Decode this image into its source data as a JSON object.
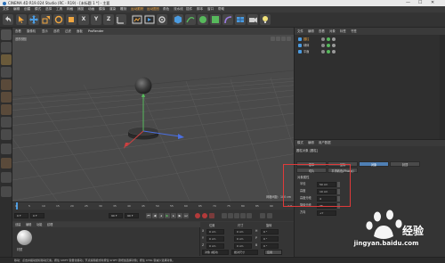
{
  "titlebar": {
    "title": "CINEMA 4D R19.024 Studio (RC - R19) - [未标题 1 *] - 主要",
    "minimize": "—",
    "maximize": "☐",
    "close": "✕"
  },
  "menubar": {
    "items": [
      "文件",
      "编辑",
      "创建",
      "模式",
      "选择",
      "工具",
      "网格",
      "捕捉",
      "动画",
      "模拟",
      "渲染",
      "雕刻",
      "运动跟踪",
      "运动图形",
      "角色",
      "流水线",
      "插件",
      "脚本",
      "窗口",
      "帮助"
    ]
  },
  "toolbar": {
    "axis_x": "X",
    "axis_y": "Y",
    "axis_z": "Z"
  },
  "viewport": {
    "menu": [
      "查看",
      "摄像机",
      "显示",
      "选项",
      "过滤",
      "面板",
      "ProRender"
    ],
    "view_label": "透视视图",
    "grid_spacing_label": "网格间距：100 cm"
  },
  "timeline": {
    "ticks": [
      "0",
      "5",
      "10",
      "15",
      "20",
      "25",
      "30",
      "35",
      "40",
      "45",
      "50",
      "55",
      "60",
      "65",
      "70",
      "75",
      "80",
      "85",
      "90"
    ],
    "end_label": "0 F",
    "start_field": "0 F",
    "current_field": "0 F",
    "end_field": "90 F",
    "max_field": "90 F"
  },
  "materials": {
    "menu": [
      "创建",
      "编辑",
      "功能",
      "纹理"
    ],
    "material_name": "材质"
  },
  "coords": {
    "headers": [
      "位置",
      "尺寸",
      "旋转"
    ],
    "rows": [
      {
        "axis": "X",
        "pos": "0 cm",
        "size": "0 cm",
        "rot_axis": "H",
        "rot": "0 °"
      },
      {
        "axis": "Y",
        "pos": "0 cm",
        "size": "0 cm",
        "rot_axis": "P",
        "rot": "0 °"
      },
      {
        "axis": "Z",
        "pos": "0 cm",
        "size": "0 cm",
        "rot_axis": "B",
        "rot": "0 °"
      }
    ],
    "mode": "对象 (相对)",
    "size_mode": "绝对尺寸",
    "apply": "应用"
  },
  "object_manager": {
    "menu": [
      "文件",
      "编辑",
      "查看",
      "对象",
      "标签",
      "书签"
    ],
    "objects": [
      "圆柱",
      "球体",
      "平面"
    ]
  },
  "attribute_manager": {
    "menu": [
      "模式",
      "编辑",
      "用户数据"
    ],
    "object_title": "圆柱对象 [圆柱]",
    "tabs_row1": [
      "基本",
      "坐标",
      "对象",
      "封顶"
    ],
    "tabs_row2": [
      "切片",
      "平滑着色(Phong)"
    ],
    "section": "对象属性",
    "props": [
      {
        "label": "半径",
        "value": "50 cm"
      },
      {
        "label": "高度",
        "value": "10 cm"
      },
      {
        "label": "高度分段",
        "value": "4"
      },
      {
        "label": "旋转分段",
        "value": "36"
      },
      {
        "label": "方向",
        "value": "+Y"
      }
    ]
  },
  "statusbar": {
    "text": "移动：点击并拖动鼠标移动元素。按住 SHIFT 键量化移动；节点编辑模式时按住 SHIFT 键增加选择对象；按住 CTRL 键减少选择对象。"
  },
  "watermark": {
    "text": "jingyan.baidu.com"
  }
}
